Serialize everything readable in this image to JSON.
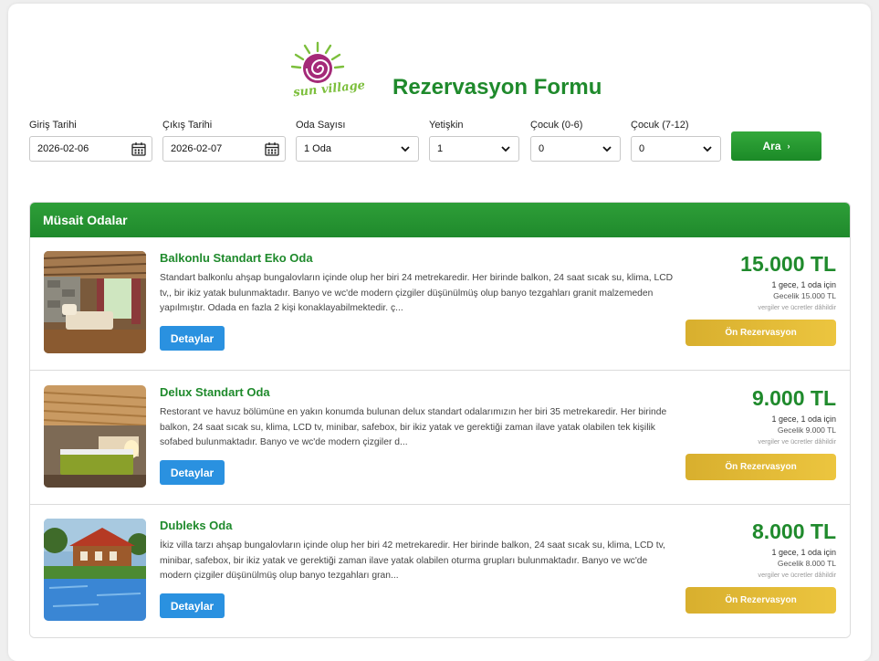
{
  "brand": {
    "logo_text": "sun village",
    "form_title": "Rezervasyon Formu"
  },
  "search": {
    "checkin": {
      "label": "Giriş Tarihi",
      "value": "2026-02-06"
    },
    "checkout": {
      "label": "Çıkış Tarihi",
      "value": "2026-02-07"
    },
    "rooms": {
      "label": "Oda Sayısı",
      "value": "1 Oda"
    },
    "adults": {
      "label": "Yetişkin",
      "value": "1"
    },
    "child_0_6": {
      "label": "Çocuk (0-6)",
      "value": "0"
    },
    "child_7_12": {
      "label": "Çocuk (7-12)",
      "value": "0"
    },
    "button_label": "Ara",
    "button_arrow": "›"
  },
  "results": {
    "heading": "Müsait Odalar",
    "rooms": [
      {
        "name": "Balkonlu Standart Eko Oda",
        "description": "Standart balkonlu ahşap bungalovların içinde olup her biri 24 metrekaredir. Her birinde balkon, 24 saat sıcak su, klima, LCD tv,, bir ikiz yatak bulunmaktadır. Banyo ve wc'de modern çizgiler düşünülmüş olup banyo tezgahları granit malzemeden yapılmıştır. Odada en fazla 2 kişi konaklayabilmektedir. ç...",
        "details_label": "Detaylar",
        "price": "15.000 TL",
        "stay_info": "1 gece, 1 oda için",
        "nightly": "Gecelik 15.000 TL",
        "tax_note": "vergiler ve ücretler dâhildir",
        "reserve_label": "Ön Rezervasyon"
      },
      {
        "name": "Delux Standart Oda",
        "description": "Restorant ve havuz bölümüne en yakın konumda bulunan delux standart odalarımızın her biri 35 metrekaredir. Her birinde balkon, 24 saat sıcak su, klima, LCD tv, minibar, safebox, bir ikiz yatak ve gerektiği zaman ilave yatak olabilen tek kişilik sofabed bulunmaktadır. Banyo ve wc'de modern çizgiler d...",
        "details_label": "Detaylar",
        "price": "9.000 TL",
        "stay_info": "1 gece, 1 oda için",
        "nightly": "Gecelik 9.000 TL",
        "tax_note": "vergiler ve ücretler dâhildir",
        "reserve_label": "Ön Rezervasyon"
      },
      {
        "name": "Dubleks Oda",
        "description": "İkiz villa tarzı ahşap bungalovların içinde olup her biri 42 metrekaredir. Her birinde balkon, 24 saat sıcak su, klima, LCD tv, minibar, safebox, bir ikiz yatak ve gerektiği zaman ilave yatak olabilen oturma grupları bulunmaktadır. Banyo ve wc'de modern çizgiler düşünülmüş olup banyo tezgahları gran...",
        "details_label": "Detaylar",
        "price": "8.000 TL",
        "stay_info": "1 gece, 1 oda için",
        "nightly": "Gecelik 8.000 TL",
        "tax_note": "vergiler ve ücretler dâhildir",
        "reserve_label": "Ön Rezervasyon"
      }
    ]
  },
  "colors": {
    "brand_green": "#1f8a2c",
    "button_blue": "#2a91e0",
    "reserve_gold": "#e3bb38"
  }
}
